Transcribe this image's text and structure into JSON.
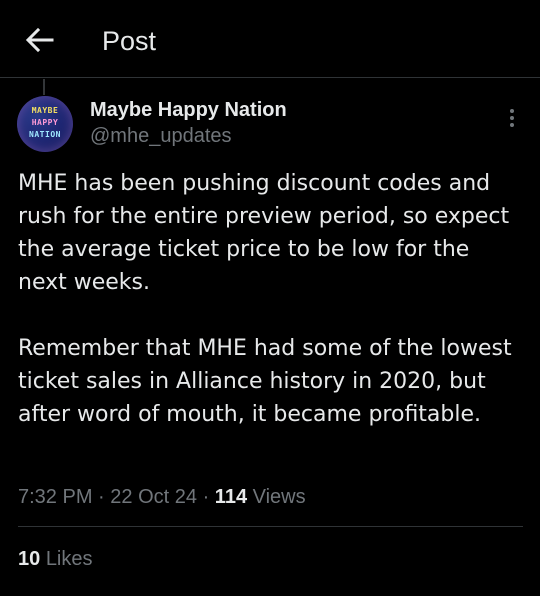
{
  "header": {
    "title": "Post",
    "back_icon": "arrow-left-icon"
  },
  "author": {
    "display_name": "Maybe Happy Nation",
    "handle": "@mhe_updates",
    "avatar_lines": [
      "MAYBE",
      "HAPPY",
      "NATION"
    ]
  },
  "tweet": {
    "paragraph1": "MHE has been pushing discount codes and rush for the entire preview period, so expect the average ticket price to be low for the next weeks.",
    "paragraph2": "Remember that MHE had some of the lowest ticket sales in Alliance history in 2020, but after word of mouth, it became profitable."
  },
  "meta": {
    "time": "7:32 PM",
    "separator": "·",
    "date": "22 Oct 24",
    "views_count": "114",
    "views_label": "Views"
  },
  "stats": {
    "likes_count": "10",
    "likes_label": "Likes"
  },
  "colors": {
    "background": "#000000",
    "text_primary": "#e7e9ea",
    "text_secondary": "#71767b",
    "border": "#2f3336"
  }
}
